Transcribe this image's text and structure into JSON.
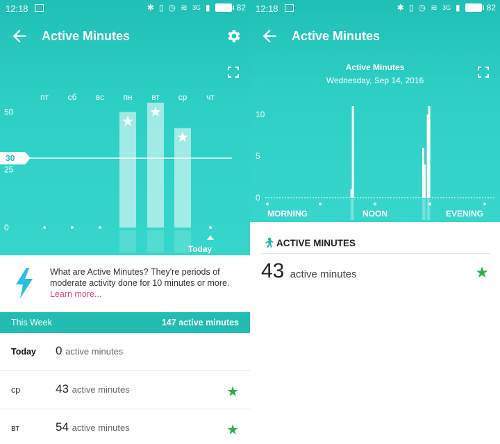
{
  "status_bar": {
    "time": "12:18",
    "signal_label": "3G",
    "battery": "82"
  },
  "left_screen": {
    "title": "Active Minutes",
    "day_labels": [
      "пт",
      "сб",
      "вс",
      "пн",
      "вт",
      "ср",
      "чт"
    ],
    "y_ticks": [
      "0",
      "25",
      "50"
    ],
    "goal_label": "30",
    "today_label": "Today",
    "chart_data": {
      "type": "bar",
      "categories": [
        "пт",
        "сб",
        "вс",
        "пн",
        "вт",
        "ср",
        "чт"
      ],
      "values": [
        0,
        0,
        0,
        50,
        54,
        43,
        0
      ],
      "goal": 30,
      "ylim": [
        0,
        60
      ],
      "star_marked": [
        false,
        false,
        false,
        true,
        true,
        true,
        false
      ]
    },
    "info": {
      "text": "What are Active Minutes? They're periods of moderate activity done for 10 minutes or more.",
      "link": "Learn more..."
    },
    "week": {
      "label": "This Week",
      "total": "147 active minutes"
    },
    "rows": [
      {
        "day": "Today",
        "value": "0",
        "unit": "active minutes",
        "star": false
      },
      {
        "day": "ср",
        "value": "43",
        "unit": "active minutes",
        "star": true
      },
      {
        "day": "вт",
        "value": "54",
        "unit": "active minutes",
        "star": true
      }
    ],
    "colors": {
      "teal": "#21bdb3",
      "link": "#e0437a",
      "star": "#2ab04a"
    }
  },
  "right_screen": {
    "title": "Active Minutes",
    "chart_title": "Active Minutes",
    "date": "Wednesday, Sep 14, 2016",
    "y_ticks": [
      "0",
      "5",
      "10"
    ],
    "x_labels": [
      "MORNING",
      "NOON",
      "EVENING"
    ],
    "chart_data": {
      "type": "bar",
      "ylim": [
        0,
        11
      ],
      "bars": [
        {
          "hour": 9.1,
          "value": 1
        },
        {
          "hour": 9.25,
          "value": 11
        },
        {
          "hour": 16.8,
          "value": 6
        },
        {
          "hour": 16.95,
          "value": 4
        },
        {
          "hour": 17.3,
          "value": 10
        },
        {
          "hour": 17.45,
          "value": 11
        }
      ]
    },
    "section_label": "ACTIVE MINUTES",
    "value": "43",
    "unit": "active minutes"
  }
}
